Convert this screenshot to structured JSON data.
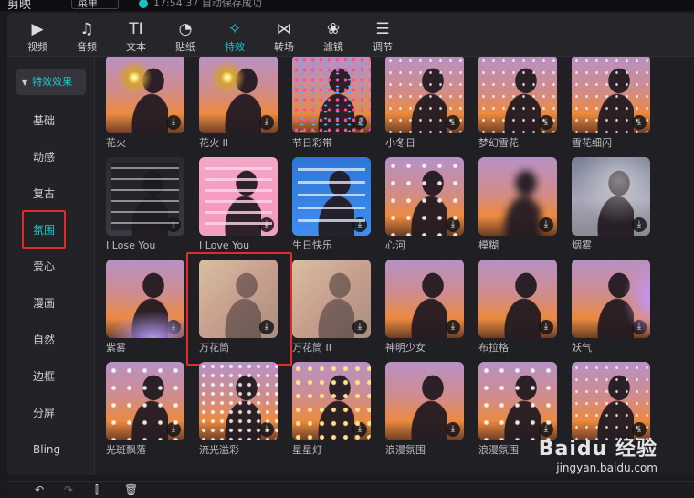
{
  "app": {
    "name": "剪映",
    "menu_label": "菜单",
    "save_status": "17:54:37 自动保存成功"
  },
  "toolbar": {
    "tools": [
      {
        "label": "视频",
        "icon": "video-icon",
        "glyph": "▶",
        "active": false
      },
      {
        "label": "音频",
        "icon": "audio-icon",
        "glyph": "♫",
        "active": false
      },
      {
        "label": "文本",
        "icon": "text-icon",
        "glyph": "TI",
        "active": false
      },
      {
        "label": "贴纸",
        "icon": "sticker-icon",
        "glyph": "◔",
        "active": false
      },
      {
        "label": "特效",
        "icon": "effects-icon",
        "glyph": "✧",
        "active": true
      },
      {
        "label": "转场",
        "icon": "transition-icon",
        "glyph": "⋈",
        "active": false
      },
      {
        "label": "滤镜",
        "icon": "filter-icon",
        "glyph": "❀",
        "active": false
      },
      {
        "label": "调节",
        "icon": "adjust-icon",
        "glyph": "☰",
        "active": false
      }
    ]
  },
  "sidebar": {
    "header": "特效效果",
    "items": [
      {
        "label": "基础",
        "active": false
      },
      {
        "label": "动感",
        "active": false
      },
      {
        "label": "复古",
        "active": false
      },
      {
        "label": "氛围",
        "active": true
      },
      {
        "label": "爱心",
        "active": false
      },
      {
        "label": "漫画",
        "active": false
      },
      {
        "label": "自然",
        "active": false
      },
      {
        "label": "边框",
        "active": false
      },
      {
        "label": "分屏",
        "active": false
      },
      {
        "label": "Bling",
        "active": false
      }
    ]
  },
  "effects": {
    "rows": [
      [
        {
          "name": "花火",
          "style": "fire"
        },
        {
          "name": "花火 II",
          "style": "fire"
        },
        {
          "name": "节日彩带",
          "style": "confetti"
        },
        {
          "name": "小冬日",
          "style": "snow"
        },
        {
          "name": "梦幻雪花",
          "style": "snow"
        },
        {
          "name": "雪花细闪",
          "style": "stars"
        }
      ],
      [
        {
          "name": "I Lose You",
          "style": "chat"
        },
        {
          "name": "I Love You",
          "style": "pink"
        },
        {
          "name": "生日快乐",
          "style": "blue"
        },
        {
          "name": "心河",
          "style": "bokeh"
        },
        {
          "name": "模糊",
          "style": "blur"
        },
        {
          "name": "烟雾",
          "style": "fog"
        }
      ],
      [
        {
          "name": "紫雾",
          "style": "purple"
        },
        {
          "name": "万花筒",
          "style": "kaleido",
          "highlighted": true
        },
        {
          "name": "万花筒 II",
          "style": "kaleido"
        },
        {
          "name": "神明少女",
          "style": "plain"
        },
        {
          "name": "布拉格",
          "style": "plain"
        },
        {
          "name": "妖气",
          "style": "glow"
        }
      ],
      [
        {
          "name": "光斑飘落",
          "style": "bokeh"
        },
        {
          "name": "流光溢彩",
          "style": "dots"
        },
        {
          "name": "星星灯",
          "style": "gold"
        },
        {
          "name": "浪漫氛围",
          "style": "plain"
        },
        {
          "name": "浪漫氛围",
          "style": "bokeh"
        },
        {
          "name": "",
          "style": "stars"
        }
      ]
    ]
  },
  "colors": {
    "accent": "#21c7c9",
    "highlight_box": "#e32b2b",
    "panel_bg": "#202024"
  },
  "watermark": {
    "brand": "Baidu 经验",
    "url": "jingyan.baidu.com"
  }
}
